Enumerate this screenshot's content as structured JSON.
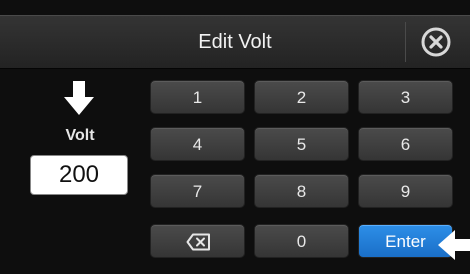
{
  "dialog": {
    "title": "Edit Volt",
    "close_icon": "close-circle-icon"
  },
  "field": {
    "label": "Volt",
    "value": "200",
    "pointer_icon": "arrow-down-icon"
  },
  "keypad": {
    "keys": [
      {
        "label": "1",
        "type": "digit"
      },
      {
        "label": "2",
        "type": "digit"
      },
      {
        "label": "3",
        "type": "digit"
      },
      {
        "label": "4",
        "type": "digit"
      },
      {
        "label": "5",
        "type": "digit"
      },
      {
        "label": "6",
        "type": "digit"
      },
      {
        "label": "7",
        "type": "digit"
      },
      {
        "label": "8",
        "type": "digit"
      },
      {
        "label": "9",
        "type": "digit"
      },
      {
        "label": "",
        "type": "backspace",
        "icon": "backspace-icon"
      },
      {
        "label": "0",
        "type": "digit"
      },
      {
        "label": "Enter",
        "type": "enter"
      }
    ],
    "enter_pointer_icon": "arrow-left-icon"
  },
  "colors": {
    "enter_accent": "#2a86e0",
    "key_background": "#404040",
    "background": "#0e0e0e"
  }
}
